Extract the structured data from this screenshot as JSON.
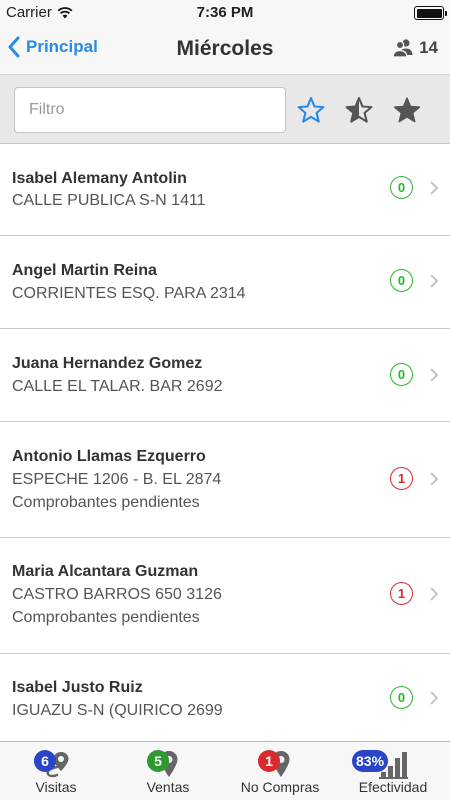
{
  "status_bar": {
    "carrier": "Carrier",
    "time": "7:36 PM"
  },
  "nav": {
    "back_label": "Principal",
    "title": "Miércoles",
    "client_count": "14"
  },
  "filter": {
    "placeholder": "Filtro",
    "value": ""
  },
  "clients": [
    {
      "name": "Isabel Alemany Antolin",
      "address": "CALLE PUBLICA S-N 1411",
      "note": "",
      "count": "0",
      "status": "green"
    },
    {
      "name": "Angel Martin Reina",
      "address": "CORRIENTES ESQ. PARA 2314",
      "note": "",
      "count": "0",
      "status": "green"
    },
    {
      "name": "Juana Hernandez Gomez",
      "address": "CALLE EL TALAR. BAR 2692",
      "note": "",
      "count": "0",
      "status": "green"
    },
    {
      "name": "Antonio Llamas Ezquerro",
      "address": "ESPECHE 1206 - B. EL 2874",
      "note": "Comprobantes pendientes",
      "count": "1",
      "status": "red"
    },
    {
      "name": "Maria Alcantara Guzman",
      "address": "CASTRO BARROS 650 3126",
      "note": "Comprobantes pendientes",
      "count": "1",
      "status": "red"
    },
    {
      "name": "Isabel Justo Ruiz",
      "address": "IGUAZU S-N (QUIRICO 2699",
      "note": "",
      "count": "0",
      "status": "green"
    }
  ],
  "tabs": [
    {
      "label": "Visitas",
      "badge": "6",
      "badge_color": "#2b45c9",
      "icon": "route-pin-icon"
    },
    {
      "label": "Ventas",
      "badge": "5",
      "badge_color": "#2c9a2c",
      "icon": "map-pin-icon"
    },
    {
      "label": "No Compras",
      "badge": "1",
      "badge_color": "#d92b2b",
      "icon": "map-pin-icon"
    },
    {
      "label": "Efectividad",
      "badge": "83%",
      "badge_color": "#2b45c9",
      "icon": "bar-chart-icon"
    }
  ],
  "colors": {
    "accent": "#2a8be6",
    "ok": "#2cb52c",
    "alert": "#d92b2b"
  }
}
